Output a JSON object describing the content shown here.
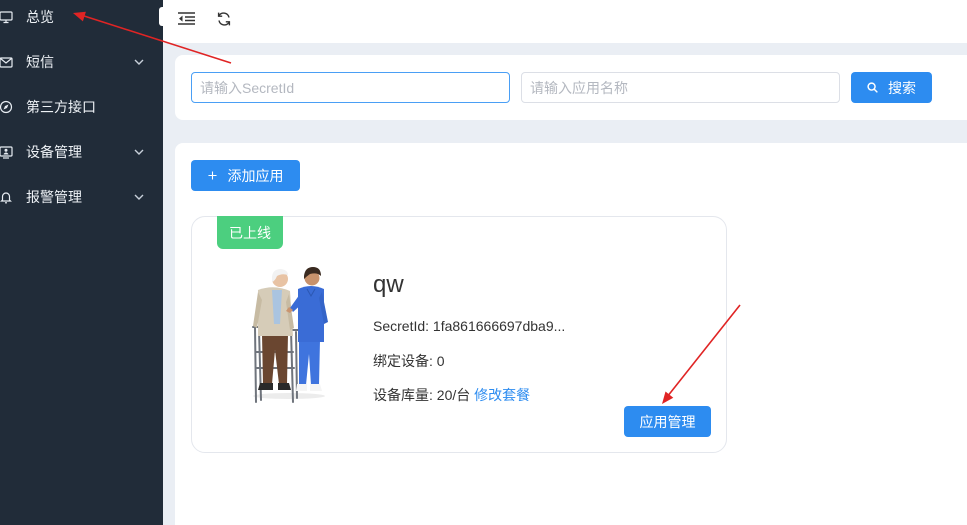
{
  "colors": {
    "sidebar_bg": "#212c39",
    "sidebar_text": "#eef2f6",
    "page_bg": "#eaeef4",
    "primary": "#2d8cf0",
    "success": "#4ccf7f",
    "focus_border": "#4a9ff5",
    "annotation": "#e02424"
  },
  "sidebar": {
    "items": [
      {
        "label": "总览",
        "icon": "monitor-icon",
        "active": true
      },
      {
        "label": "短信",
        "icon": "envelope-icon",
        "submenu_icon": "chevron-down-icon"
      },
      {
        "label": "第三方接口",
        "icon": "compass-icon"
      },
      {
        "label": "设备管理",
        "icon": "device-icon",
        "submenu_icon": "chevron-down-icon"
      },
      {
        "label": "报警管理",
        "icon": "bell-icon",
        "submenu_icon": "chevron-down-icon"
      }
    ]
  },
  "header": {
    "toggle_icon": "outdent-icon",
    "refresh_icon": "refresh-icon"
  },
  "search": {
    "secret_id": {
      "placeholder": "请输入SecretId",
      "value": ""
    },
    "app_name": {
      "placeholder": "请输入应用名称",
      "value": ""
    },
    "button": {
      "label": "搜索",
      "icon": "search-icon"
    }
  },
  "apps": {
    "add_button": {
      "label": "添加应用",
      "icon": "plus-icon"
    },
    "cards": [
      {
        "status": "已上线",
        "name": "qw",
        "secret_id": {
          "label": "SecretId:",
          "value": "1fa861666697dba9..."
        },
        "bound_devices": {
          "label": "绑定设备:",
          "value": "0"
        },
        "capacity": {
          "label": "设备库量:",
          "value": "20/台"
        },
        "change_plan_label": "修改套餐",
        "manage_label": "应用管理"
      }
    ]
  }
}
